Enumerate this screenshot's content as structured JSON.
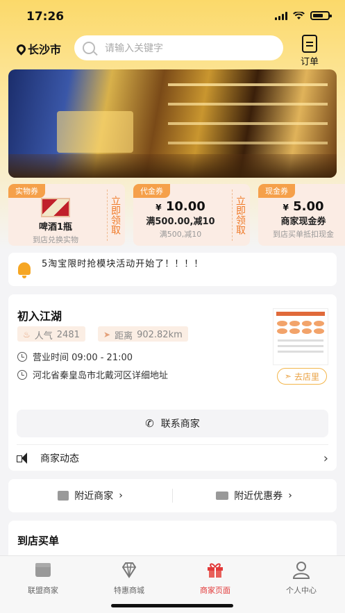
{
  "status_bar": {
    "time": "17:26"
  },
  "header": {
    "city": "长沙市",
    "search_placeholder": "请输入关键字",
    "orders_label": "订单"
  },
  "coupons": [
    {
      "tag": "实物券",
      "name": "啤酒1瓶",
      "sub": "到店兑换实物",
      "claim": "立即领取"
    },
    {
      "tag": "代金券",
      "currency": "¥",
      "amount": "10.00",
      "name": "满500.00,减10",
      "sub": "满500,减10",
      "claim": "立即领取"
    },
    {
      "tag": "现金券",
      "currency": "¥",
      "amount": "5.00",
      "name": "商家现金券",
      "sub": "到店买单抵扣现金"
    }
  ],
  "notice": {
    "text": "5淘宝限时抢模块活动开始了！！！！"
  },
  "store": {
    "name": "初入江湖",
    "popularity_label": "人气",
    "popularity": "2481",
    "distance_label": "距离",
    "distance": "902.82km",
    "hours": "营业时间 09:00 - 21:00",
    "address": "河北省秦皇岛市北戴河区详细地址",
    "go_label": "去店里",
    "contact_label": "联系商家",
    "news_label": "商家动态"
  },
  "nearby": {
    "merchants_label": "附近商家",
    "coupons_label": "附近优惠券"
  },
  "buy": {
    "title": "到店买单"
  },
  "tabbar": [
    {
      "label": "联盟商家",
      "active": false
    },
    {
      "label": "特惠商城",
      "active": false
    },
    {
      "label": "商家页面",
      "active": true
    },
    {
      "label": "个人中心",
      "active": false
    }
  ],
  "colors": {
    "accent": "#f5a04a",
    "active_tab": "#e23a3a",
    "header_yellow": "#fbd96a"
  }
}
